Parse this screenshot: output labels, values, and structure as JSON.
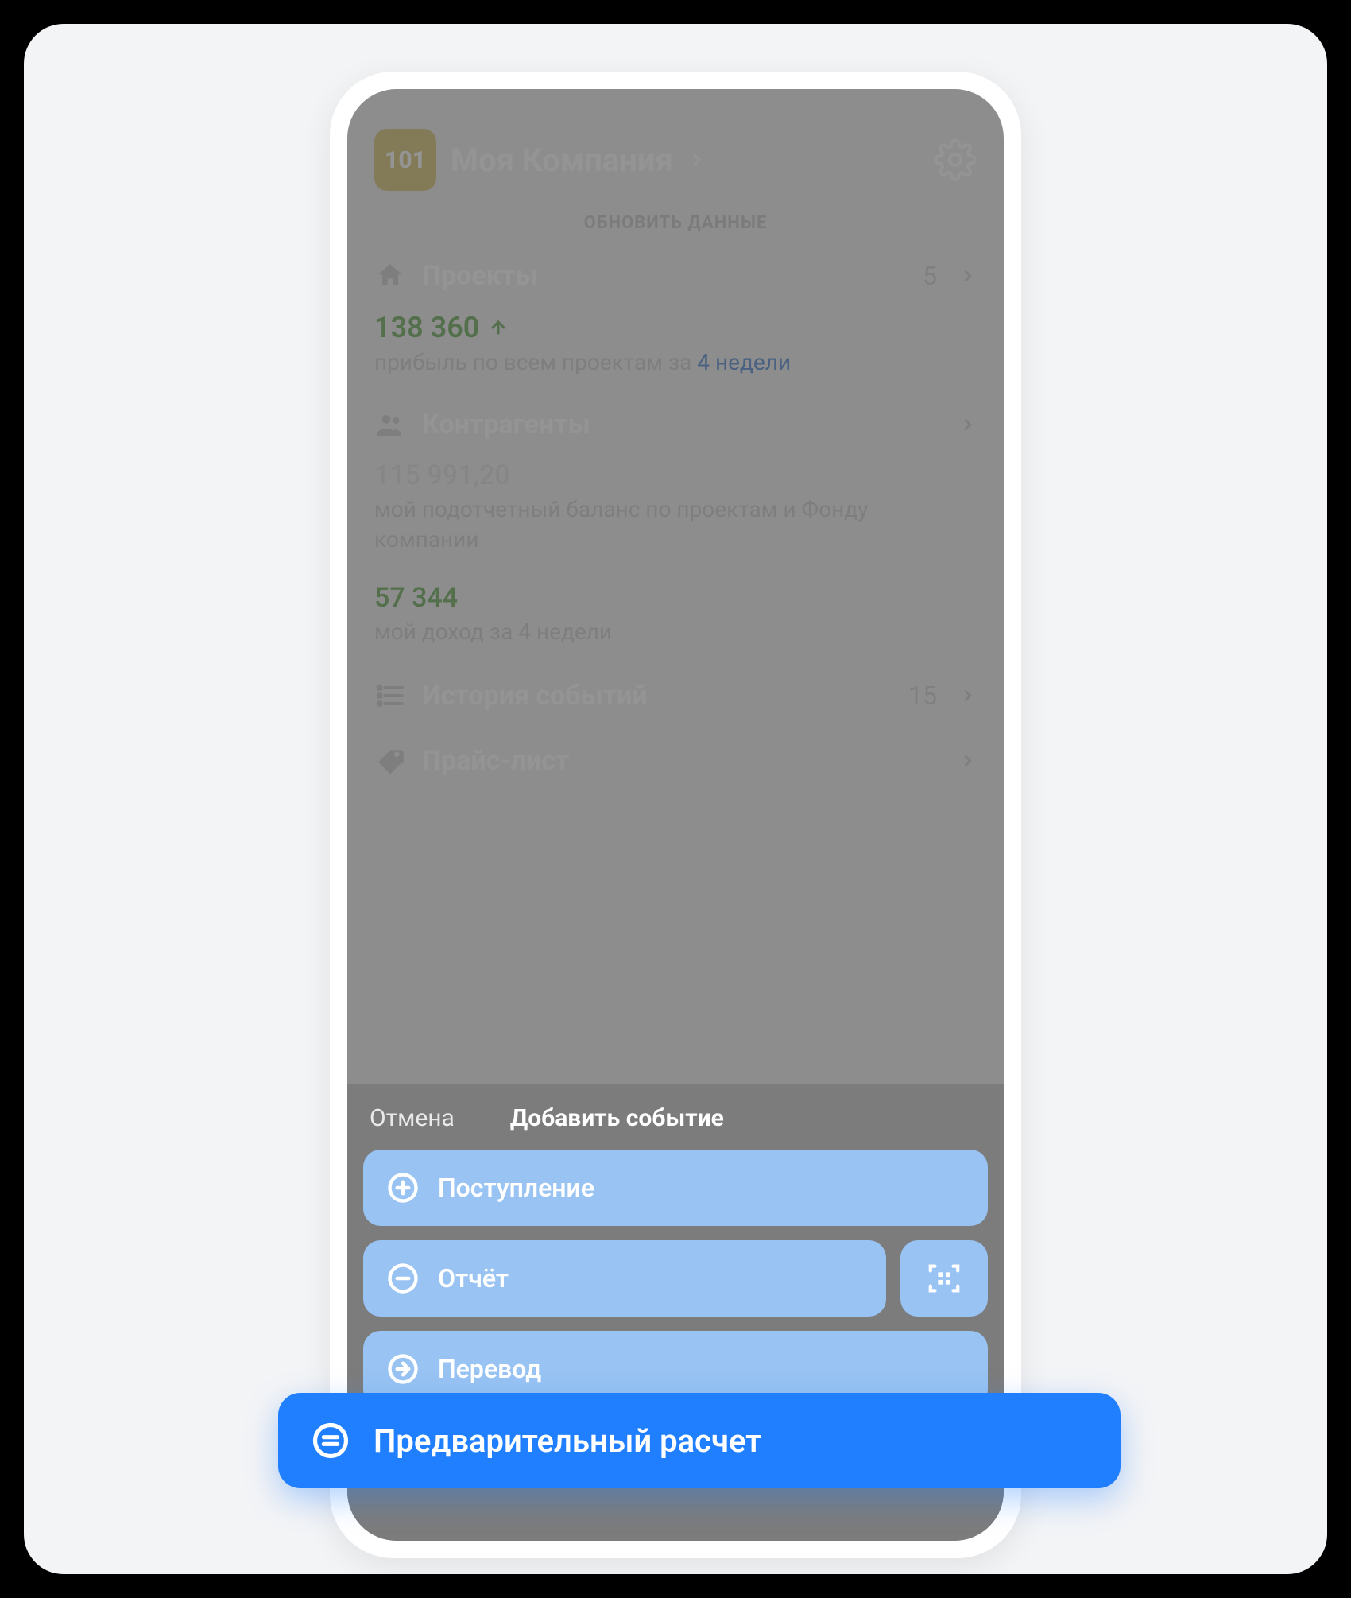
{
  "logo_text": "101",
  "company_name": "Моя Компания",
  "refresh_label": "ОБНОВИТЬ ДАННЫЕ",
  "projects": {
    "label": "Проекты",
    "count": "5",
    "profit_value": "138 360",
    "profit_sub_prefix": "прибыль по всем проектам за ",
    "profit_sub_period": "4 недели"
  },
  "counterparties": {
    "label": "Контрагенты",
    "balance_value": "115 991,20",
    "balance_sub": "мой подотчетный баланс по проектам и Фонду компании",
    "income_value": "57 344",
    "income_sub": "мой доход за 4 недели"
  },
  "history": {
    "label": "История событий",
    "count": "15"
  },
  "pricelist": {
    "label": "Прайс-лист"
  },
  "sheet": {
    "cancel": "Отмена",
    "title": "Добавить событие",
    "options": {
      "income": "Поступление",
      "report": "Отчёт",
      "transfer": "Перевод"
    }
  },
  "highlight": {
    "label": "Предварительный расчет"
  }
}
